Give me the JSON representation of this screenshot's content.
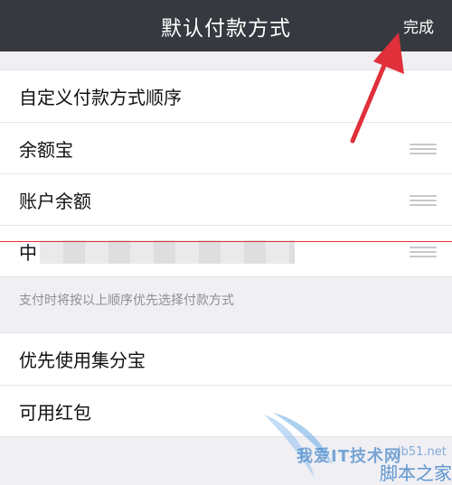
{
  "navbar": {
    "title": "默认付款方式",
    "done_label": "完成"
  },
  "payment_order": {
    "items": [
      {
        "label": "自定义付款方式顺序"
      },
      {
        "label": "余额宝"
      },
      {
        "label": "账户余额"
      },
      {
        "label": "中"
      }
    ]
  },
  "hint": "支付时将按以上顺序优先选择付款方式",
  "options": {
    "items": [
      {
        "label": "优先使用集分宝"
      },
      {
        "label": "可用红包"
      }
    ]
  },
  "watermark": {
    "line1": "我爱IT技术网",
    "line2": "jb51.net",
    "line3": "脚本之家"
  },
  "colors": {
    "navbar_bg": "#36393f",
    "annotation_arrow": "#e0303a",
    "watermark": "#3a7fc4"
  }
}
